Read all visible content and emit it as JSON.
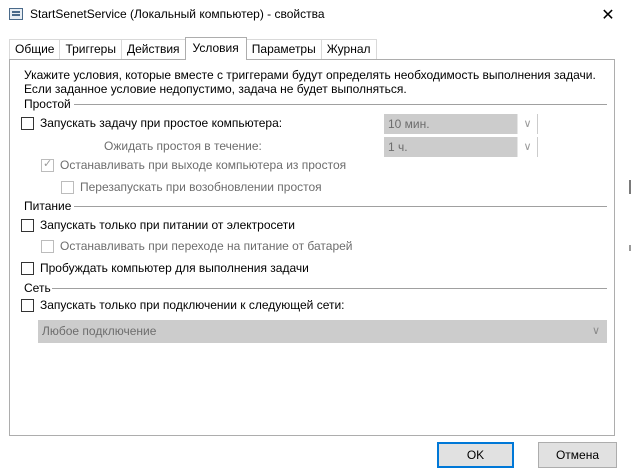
{
  "window": {
    "title": "StartSenetService (Локальный компьютер) - свойства",
    "close_glyph": "✕"
  },
  "tabs": [
    {
      "label": "Общие",
      "active": false
    },
    {
      "label": "Триггеры",
      "active": false
    },
    {
      "label": "Действия",
      "active": false
    },
    {
      "label": "Условия",
      "active": true
    },
    {
      "label": "Параметры",
      "active": false
    },
    {
      "label": "Журнал",
      "active": false
    }
  ],
  "description": {
    "line1": "Укажите условия, которые вместе с триггерами будут определять необходимость выполнения задачи.",
    "line2": "Если заданное условие недопустимо, задача не будет выполняться."
  },
  "idle": {
    "header": "Простой",
    "start_on_idle": {
      "label": "Запускать задачу при простое компьютера:",
      "checked": false
    },
    "idle_duration": {
      "value": "10 мин."
    },
    "wait_label": "Ожидать простоя в течение:",
    "wait_duration": {
      "value": "1 ч."
    },
    "stop_on_idle_end": {
      "label": "Останавливать при выходе компьютера из простоя",
      "checked": true
    },
    "restart_on_idle": {
      "label": "Перезапускать при возобновлении простоя",
      "checked": false
    }
  },
  "power": {
    "header": "Питание",
    "ac_only": {
      "label": "Запускать только при питании от электросети",
      "checked": false
    },
    "stop_on_battery": {
      "label": "Останавливать при переходе на питание от батарей",
      "checked": false
    },
    "wake": {
      "label": "Пробуждать компьютер для выполнения задачи",
      "checked": false
    }
  },
  "network": {
    "header": "Сеть",
    "network_only": {
      "label": "Запускать только при подключении к следующей сети:",
      "checked": false
    },
    "connection": {
      "value": "Любое подключение"
    }
  },
  "buttons": {
    "ok": "OK",
    "cancel": "Отмена"
  },
  "colors": {
    "accent": "#0078d7",
    "disabled_fill": "#cccccc",
    "disabled_text": "#6d6d6d"
  }
}
